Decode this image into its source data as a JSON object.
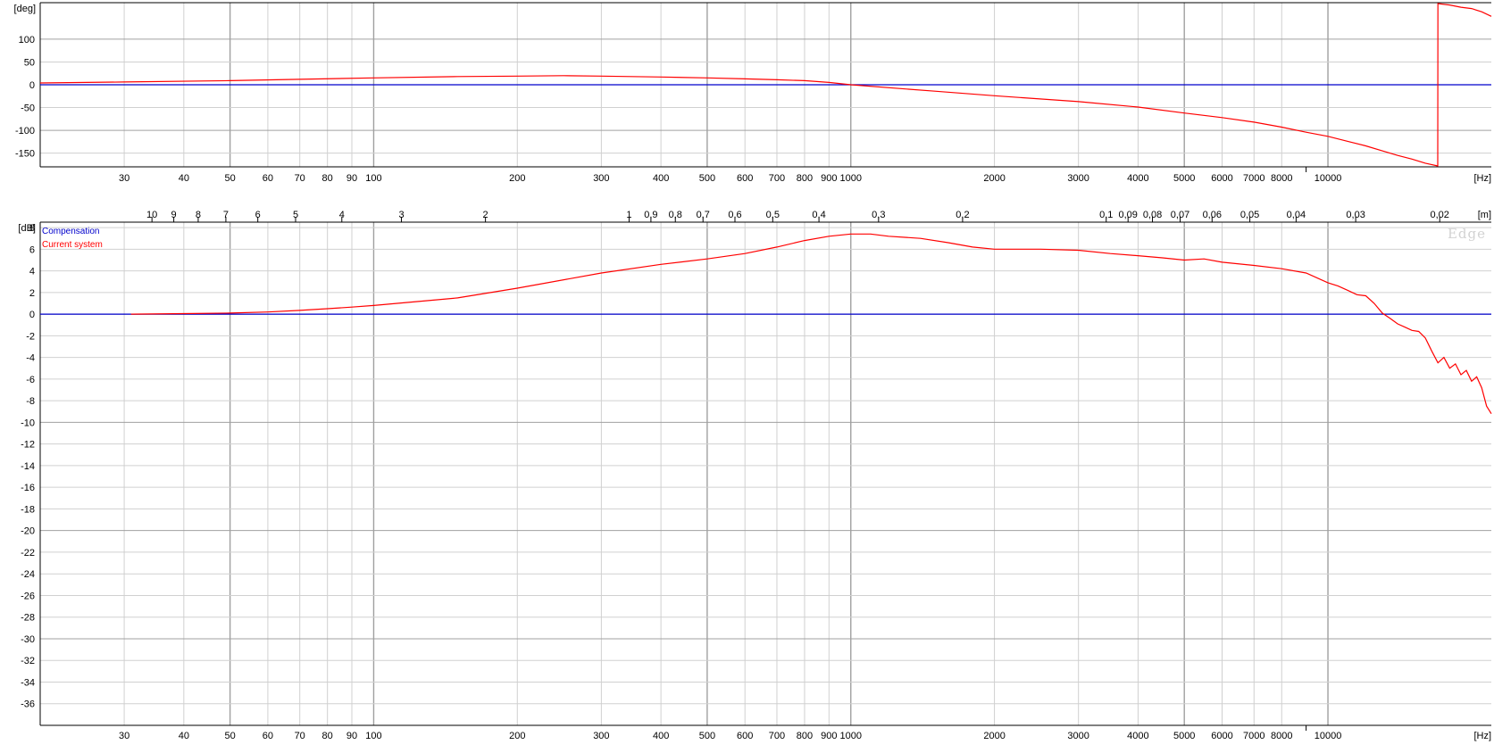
{
  "watermark": "Edge",
  "colors": {
    "compensation": "#0000cc",
    "current": "#ff0000",
    "grid_major": "#a0a0a0",
    "grid_minor": "#d0d0d0"
  },
  "freq_ticks": [
    30,
    40,
    50,
    60,
    70,
    80,
    90,
    100,
    200,
    300,
    400,
    500,
    600,
    700,
    800,
    900,
    1000,
    2000,
    3000,
    4000,
    5000,
    6000,
    7000,
    8000,
    10000
  ],
  "freq_unit": "[Hz]",
  "chart_data": [
    {
      "type": "line",
      "ylabel": "[deg]",
      "xscale": "log",
      "xlim": [
        20,
        22000
      ],
      "ylim": [
        -180,
        180
      ],
      "yticks": [
        100,
        50,
        0,
        -50,
        -100,
        -150
      ],
      "series": [
        {
          "name": "",
          "color": "#0000cc",
          "x": [
            20,
            22000
          ],
          "y": [
            0,
            0
          ]
        },
        {
          "name": "",
          "color": "#ff0000",
          "x": [
            20,
            30,
            50,
            70,
            100,
            150,
            200,
            250,
            300,
            400,
            500,
            600,
            700,
            800,
            900,
            1000,
            1500,
            2000,
            3000,
            4000,
            5000,
            6000,
            7000,
            8000,
            9000,
            10000,
            11000,
            12000,
            13000,
            14000,
            15000,
            16000,
            16990,
            17000,
            18000,
            19000,
            20000,
            21000,
            22000
          ],
          "y": [
            4,
            6,
            9,
            12,
            15,
            18,
            19,
            20,
            19,
            17,
            15,
            13,
            11,
            9,
            5,
            0,
            -14,
            -24,
            -37,
            -49,
            -62,
            -72,
            -82,
            -93,
            -104,
            -113,
            -124,
            -134,
            -145,
            -155,
            -163,
            -172,
            -178,
            178,
            175,
            170,
            167,
            160,
            150
          ]
        }
      ]
    },
    {
      "type": "line",
      "ylabel": "[dB]",
      "xscale": "log",
      "xlim": [
        20,
        22000
      ],
      "ylim": [
        -38,
        8.5
      ],
      "yticks": [
        8,
        6,
        4,
        2,
        0,
        -2,
        -4,
        -6,
        -8,
        -10,
        -12,
        -14,
        -16,
        -18,
        -20,
        -22,
        -24,
        -26,
        -28,
        -30,
        -32,
        -34,
        -36
      ],
      "top_axis": {
        "unit": "[m]",
        "ticks": [
          10,
          9,
          8,
          7,
          6,
          5,
          4,
          3,
          2,
          1,
          0.9,
          0.8,
          0.7,
          0.6,
          0.5,
          0.4,
          0.3,
          0.2,
          0.1,
          0.09,
          0.08,
          0.07,
          0.06,
          0.05,
          0.04,
          0.03,
          0.02
        ],
        "labels": [
          "10",
          "9",
          "8",
          "7",
          "6",
          "5",
          "4",
          "3",
          "2",
          "1",
          "0,9",
          "0,8",
          "0,7",
          "0,6",
          "0,5",
          "0,4",
          "0,3",
          "0,2",
          "0,1",
          "0,09",
          "0,08",
          "0,07",
          "0,06",
          "0,05",
          "0,04",
          "0,03",
          "0,02"
        ]
      },
      "series": [
        {
          "name": "Compensation",
          "color": "#0000cc",
          "x": [
            20,
            22000
          ],
          "y": [
            0,
            0
          ]
        },
        {
          "name": "Current system",
          "color": "#ff0000",
          "x": [
            31,
            40,
            50,
            60,
            70,
            80,
            90,
            100,
            150,
            200,
            300,
            400,
            500,
            600,
            700,
            800,
            900,
            1000,
            1100,
            1200,
            1400,
            1600,
            1800,
            2000,
            2500,
            3000,
            3500,
            4000,
            4500,
            5000,
            5500,
            6000,
            7000,
            8000,
            9000,
            10000,
            10500,
            11000,
            11500,
            12000,
            12500,
            13000,
            13500,
            14000,
            14500,
            15000,
            15500,
            16000,
            16500,
            17000,
            17500,
            18000,
            18500,
            19000,
            19500,
            20000,
            20500,
            21000,
            21500,
            22000
          ],
          "y": [
            0,
            0.05,
            0.1,
            0.2,
            0.35,
            0.5,
            0.65,
            0.8,
            1.5,
            2.4,
            3.8,
            4.6,
            5.1,
            5.6,
            6.2,
            6.8,
            7.2,
            7.4,
            7.4,
            7.2,
            7.0,
            6.6,
            6.2,
            6.0,
            6.0,
            5.9,
            5.6,
            5.4,
            5.2,
            5.0,
            5.1,
            4.8,
            4.5,
            4.2,
            3.8,
            2.9,
            2.6,
            2.2,
            1.8,
            1.7,
            1.0,
            0.1,
            -0.4,
            -0.9,
            -1.2,
            -1.5,
            -1.6,
            -2.2,
            -3.4,
            -4.5,
            -4.0,
            -5.0,
            -4.6,
            -5.6,
            -5.2,
            -6.2,
            -5.8,
            -6.8,
            -8.5,
            -9.2
          ]
        }
      ]
    }
  ]
}
